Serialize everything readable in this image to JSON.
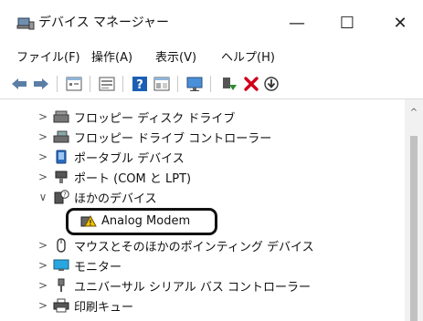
{
  "window": {
    "title": "デバイス マネージャー",
    "min_glyph": "—",
    "max_glyph": "☐",
    "close_glyph": "✕"
  },
  "menu": {
    "file": "ファイル(F)",
    "operation": "操作(A)",
    "view": "表示(V)",
    "help": "ヘルプ(H)"
  },
  "toolbar": {
    "icons": [
      "back-arrow-icon",
      "forward-arrow-icon",
      "properties-icon",
      "show-list-icon",
      "help-icon",
      "details-icon",
      "scan-monitor-icon",
      "update-driver-icon",
      "uninstall-icon",
      "install-icon"
    ]
  },
  "tree": {
    "items": [
      {
        "label": "フロッピー ディスク ドライブ",
        "expander": ">",
        "icon": "floppy-disk-icon"
      },
      {
        "label": "フロッピー ドライブ コントローラー",
        "expander": ">",
        "icon": "floppy-controller-icon"
      },
      {
        "label": "ポータブル デバイス",
        "expander": ">",
        "icon": "portable-device-icon"
      },
      {
        "label": "ポート (COM と LPT)",
        "expander": ">",
        "icon": "port-icon"
      },
      {
        "label": "ほかのデバイス",
        "expander": "∨",
        "icon": "unknown-device-icon"
      },
      {
        "label": "Analog Modem",
        "expander": "",
        "icon": "warning-device-icon"
      },
      {
        "label": "マウスとそのほかのポインティング デバイス",
        "expander": ">",
        "icon": "mouse-icon"
      },
      {
        "label": "モニター",
        "expander": ">",
        "icon": "monitor-icon"
      },
      {
        "label": "ユニバーサル シリアル バス コントローラー",
        "expander": ">",
        "icon": "usb-icon"
      },
      {
        "label": "印刷キュー",
        "expander": ">",
        "icon": "printer-icon"
      }
    ]
  },
  "colors": {
    "uninstall_red": "#d0021b",
    "accent_blue": "#1a6fd0",
    "update_green": "#2e8b2e"
  }
}
